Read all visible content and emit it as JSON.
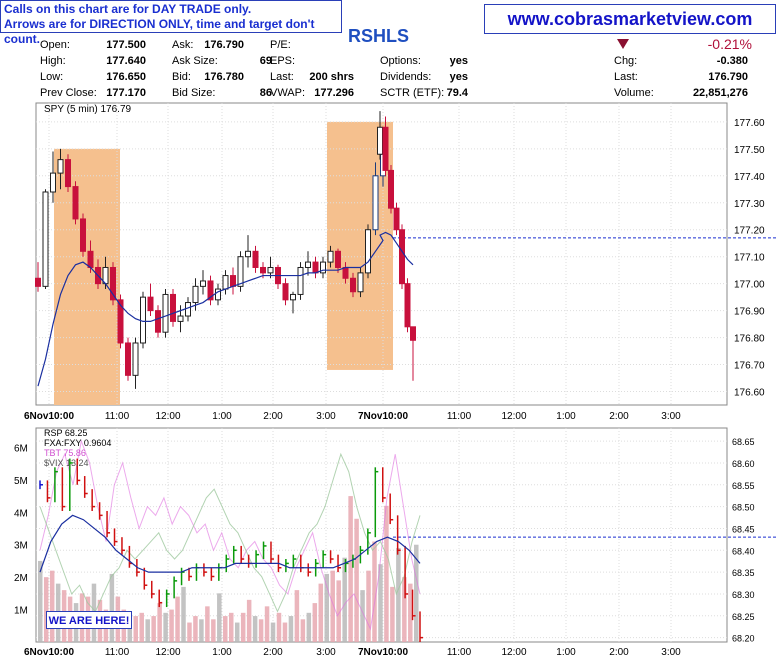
{
  "notice": {
    "line1": "Calls on this chart are for DAY TRADE only.",
    "line2": "Arrows are for DIRECTION ONLY, time and target don't count."
  },
  "site": "www.cobrasmarketview.com",
  "symbol": "RSHLS",
  "quote": {
    "open_label": "Open:",
    "open": "177.500",
    "high_label": "High:",
    "high": "177.640",
    "low_label": "Low:",
    "low": "176.650",
    "prev_label": "Prev Close:",
    "prev": "177.170",
    "ask_label": "Ask:",
    "ask": "176.790",
    "asksize_label": "Ask Size:",
    "asksize": "69",
    "bid_label": "Bid:",
    "bid": "176.780",
    "bidsize_label": "Bid Size:",
    "bidsize": "86",
    "pe_label": "P/E:",
    "eps_label": "EPS:",
    "last_label": "Last:",
    "last_shares": "200 shrs",
    "vwap_label": "VWAP:",
    "vwap": "177.296",
    "options_label": "Options:",
    "options": "yes",
    "dividends_label": "Dividends:",
    "dividends": "yes",
    "sctr_label": "SCTR (ETF):",
    "sctr": "79.4",
    "pct_change": "-0.21%",
    "chg_label": "Chg:",
    "chg": "-0.380",
    "last2_label": "Last:",
    "last2": "176.790",
    "volume_label": "Volume:",
    "volume": "22,851,276"
  },
  "colors": {
    "up": "#222222",
    "down": "#c8103c",
    "ma": "#1a2fa0",
    "highlight": "#f5c08e",
    "ref_line": "#1a2fd0",
    "rsp_up": "#0a9a0a",
    "rsp_down": "#d01010",
    "rsp_blue": "#1414d0",
    "tbt": "#e070e0",
    "vix": "#9fc89f",
    "volume": "#e8a8b0"
  },
  "here_label": "WE ARE HERE!",
  "chart_data": [
    {
      "type": "line",
      "title": "SPY (5 min) 176.79",
      "chart_style": "candlestick",
      "x_ticks": [
        "6Nov10:00",
        "11:00",
        "12:00",
        "1:00",
        "2:00",
        "3:00",
        "7Nov10:00",
        "11:00",
        "12:00",
        "1:00",
        "2:00",
        "3:00"
      ],
      "y_ticks": [
        176.6,
        176.7,
        176.8,
        176.9,
        177.0,
        177.1,
        177.2,
        177.3,
        177.4,
        177.5,
        177.6
      ],
      "ylim": [
        176.55,
        177.67
      ],
      "reference_line": 177.17,
      "highlight_regions": [
        [
          "10:10",
          "11:00"
        ],
        [
          "3:00",
          "7Nov10:00"
        ]
      ],
      "series": [
        {
          "values": [
            [
              177.02,
              177.08,
              176.97,
              176.99
            ],
            [
              176.99,
              177.35,
              176.98,
              177.34
            ],
            [
              177.34,
              177.49,
              177.3,
              177.41
            ],
            [
              177.41,
              177.5,
              177.35,
              177.46
            ],
            [
              177.46,
              177.48,
              177.34,
              177.36
            ],
            [
              177.36,
              177.38,
              177.22,
              177.24
            ],
            [
              177.24,
              177.26,
              177.1,
              177.12
            ],
            [
              177.12,
              177.16,
              177.04,
              177.06
            ],
            [
              177.06,
              177.09,
              176.98,
              177.0
            ],
            [
              177.0,
              177.1,
              176.98,
              177.06
            ],
            [
              177.06,
              177.08,
              176.92,
              176.94
            ],
            [
              176.94,
              176.96,
              176.76,
              176.78
            ],
            [
              176.78,
              176.8,
              176.64,
              176.66
            ],
            [
              176.66,
              176.8,
              176.61,
              176.78
            ],
            [
              176.78,
              176.97,
              176.76,
              176.95
            ],
            [
              176.95,
              177.0,
              176.88,
              176.9
            ],
            [
              176.9,
              176.92,
              176.8,
              176.82
            ],
            [
              176.82,
              176.98,
              176.8,
              176.96
            ],
            [
              176.96,
              176.98,
              176.84,
              176.86
            ],
            [
              176.86,
              176.92,
              176.82,
              176.88
            ],
            [
              176.88,
              176.95,
              176.86,
              176.93
            ],
            [
              176.93,
              177.02,
              176.9,
              176.99
            ],
            [
              176.99,
              177.05,
              176.96,
              177.01
            ],
            [
              177.01,
              177.03,
              176.92,
              176.94
            ],
            [
              176.94,
              177.0,
              176.92,
              176.98
            ],
            [
              176.98,
              177.05,
              176.96,
              177.03
            ],
            [
              177.03,
              177.06,
              176.96,
              176.99
            ],
            [
              176.99,
              177.12,
              176.97,
              177.1
            ],
            [
              177.1,
              177.18,
              177.06,
              177.12
            ],
            [
              177.12,
              177.14,
              177.04,
              177.06
            ],
            [
              177.06,
              177.08,
              177.02,
              177.04
            ],
            [
              177.04,
              177.1,
              177.02,
              177.06
            ],
            [
              177.06,
              177.07,
              176.98,
              177.0
            ],
            [
              177.0,
              177.02,
              176.92,
              176.94
            ],
            [
              176.94,
              176.97,
              176.89,
              176.96
            ],
            [
              176.96,
              177.08,
              176.94,
              177.06
            ],
            [
              177.06,
              177.12,
              177.03,
              177.08
            ],
            [
              177.08,
              177.1,
              177.02,
              177.04
            ],
            [
              177.04,
              177.1,
              177.02,
              177.08
            ],
            [
              177.08,
              177.14,
              177.06,
              177.12
            ],
            [
              177.12,
              177.13,
              177.04,
              177.06
            ],
            [
              177.06,
              177.08,
              177.0,
              177.02
            ],
            [
              177.02,
              177.04,
              176.95,
              176.97
            ],
            [
              176.97,
              177.06,
              176.95,
              177.04
            ],
            [
              177.04,
              177.22,
              177.02,
              177.2
            ],
            [
              177.2,
              177.45,
              177.18,
              177.4
            ],
            [
              177.4,
              177.52,
              177.36,
              177.48
            ],
            [
              177.48,
              177.64,
              177.46,
              177.58
            ],
            [
              177.58,
              177.62,
              177.4,
              177.42
            ],
            [
              177.42,
              177.44,
              177.26,
              177.28
            ],
            [
              177.28,
              177.3,
              177.18,
              177.2
            ],
            [
              177.2,
              177.22,
              176.98,
              177.0
            ],
            [
              177.0,
              177.02,
              176.82,
              176.84
            ],
            [
              176.84,
              176.84,
              176.64,
              176.79
            ]
          ]
        },
        {
          "name": "MA",
          "values": [
            176.62,
            176.72,
            176.85,
            176.96,
            177.03,
            177.07,
            177.08,
            177.06,
            177.03,
            177.0,
            176.96,
            176.92,
            176.89,
            176.87,
            176.86,
            176.86,
            176.87,
            176.88,
            176.89,
            176.9,
            176.91,
            176.92,
            176.93,
            176.95,
            176.97,
            176.98,
            176.99,
            177.0,
            177.01,
            177.02,
            177.03,
            177.03,
            177.03,
            177.03,
            177.03,
            177.03,
            177.04,
            177.04,
            177.05,
            177.05,
            177.05,
            177.06,
            177.06,
            177.06,
            177.08,
            177.12,
            177.16,
            177.18,
            177.19,
            177.18,
            177.15,
            177.12,
            177.09,
            177.07
          ]
        }
      ]
    },
    {
      "type": "bar",
      "title": "RSP 68.25",
      "legend": [
        "FXA:FXY 0.9604",
        "TBT 75.86",
        "$VIX 13.24"
      ],
      "x_ticks": [
        "6Nov10:00",
        "11:00",
        "12:00",
        "1:00",
        "2:00",
        "3:00",
        "7Nov10:00",
        "11:00",
        "12:00",
        "1:00",
        "2:00",
        "3:00"
      ],
      "volume_ticks": [
        "1M",
        "2M",
        "3M",
        "4M",
        "5M",
        "6M"
      ],
      "y_ticks": [
        68.2,
        68.25,
        68.3,
        68.35,
        68.4,
        68.45,
        68.5,
        68.55,
        68.6,
        68.65
      ],
      "ylim": [
        68.19,
        68.68
      ],
      "reference_line": 68.43,
      "volume_values": [
        2.5,
        2.0,
        2.2,
        1.8,
        1.6,
        1.4,
        1.2,
        1.5,
        1.4,
        1.8,
        1.3,
        1.0,
        2.1,
        1.4,
        1.0,
        0.9,
        0.8,
        0.9,
        0.7,
        0.8,
        1.2,
        0.9,
        1.0,
        1.4,
        1.7,
        0.6,
        0.8,
        0.7,
        1.1,
        0.7,
        1.5,
        0.8,
        0.9,
        0.6,
        0.9,
        1.3,
        0.8,
        0.7,
        1.1,
        0.6,
        0.9,
        0.6,
        0.8,
        1.6,
        0.7,
        0.9,
        1.2,
        1.8,
        2.1,
        2.2,
        1.9,
        2.6,
        4.5,
        3.8,
        1.6,
        2.2,
        3.1,
        2.4,
        4.2,
        1.7,
        2.9,
        2.0,
        1.8,
        3.0
      ],
      "series": [
        {
          "name": "RSP",
          "values": [
            68.55,
            68.52,
            68.58,
            68.5,
            68.6,
            68.56,
            68.53,
            68.5,
            68.48,
            68.44,
            68.42,
            68.4,
            68.37,
            68.35,
            68.32,
            68.3,
            68.28,
            68.3,
            68.33,
            68.35,
            68.34,
            68.36,
            68.35,
            68.34,
            68.36,
            68.38,
            68.4,
            68.38,
            68.37,
            68.39,
            68.41,
            68.38,
            68.36,
            68.37,
            68.38,
            68.36,
            68.35,
            68.37,
            68.39,
            68.38,
            68.36,
            68.37,
            68.38,
            68.4,
            68.44,
            68.58,
            68.52,
            68.47,
            68.4,
            68.3,
            68.25,
            68.2
          ]
        },
        {
          "name": "RSP average",
          "values": [
            68.35,
            68.42,
            68.46,
            68.48,
            68.47,
            68.45,
            68.43,
            68.4,
            68.38,
            68.36,
            68.35,
            68.35,
            68.35,
            68.35,
            68.36,
            68.36,
            68.36,
            68.36,
            68.37,
            68.37,
            68.37,
            68.37,
            68.37,
            68.36,
            68.36,
            68.36,
            68.36,
            68.36,
            68.37,
            68.38,
            68.4,
            68.42,
            68.43,
            68.42,
            68.4,
            68.37
          ]
        },
        {
          "name": "TBT",
          "values": [
            68.4,
            68.48,
            68.58,
            68.62,
            68.55,
            68.65,
            68.6,
            68.5,
            68.42,
            68.55,
            68.6,
            68.52,
            68.45,
            68.5,
            68.48,
            68.52,
            68.46,
            68.5,
            68.48,
            68.44,
            68.46,
            68.4,
            68.44,
            68.38,
            68.36,
            68.4,
            68.42,
            68.38,
            68.36,
            68.32,
            68.3,
            68.36,
            68.4,
            68.44,
            68.36,
            68.3,
            68.25,
            68.28,
            68.3,
            68.26,
            68.22,
            68.34,
            68.52,
            68.62,
            68.5,
            68.38,
            68.3
          ]
        },
        {
          "name": "$VIX",
          "values": [
            68.5,
            68.45,
            68.4,
            68.35,
            68.3,
            68.32,
            68.28,
            68.26,
            68.3,
            68.34,
            68.36,
            68.4,
            68.38,
            68.4,
            68.42,
            68.44,
            68.4,
            68.38,
            68.4,
            68.44,
            68.48,
            68.52,
            68.54,
            68.5,
            68.46,
            68.44,
            68.4,
            68.36,
            68.34,
            68.3,
            68.26,
            68.3,
            68.36,
            68.4,
            68.44,
            68.46,
            68.5,
            68.56,
            68.62,
            68.58,
            68.5,
            68.44,
            68.4,
            68.42,
            68.38,
            68.3,
            68.34,
            68.42,
            68.48
          ]
        }
      ]
    }
  ]
}
